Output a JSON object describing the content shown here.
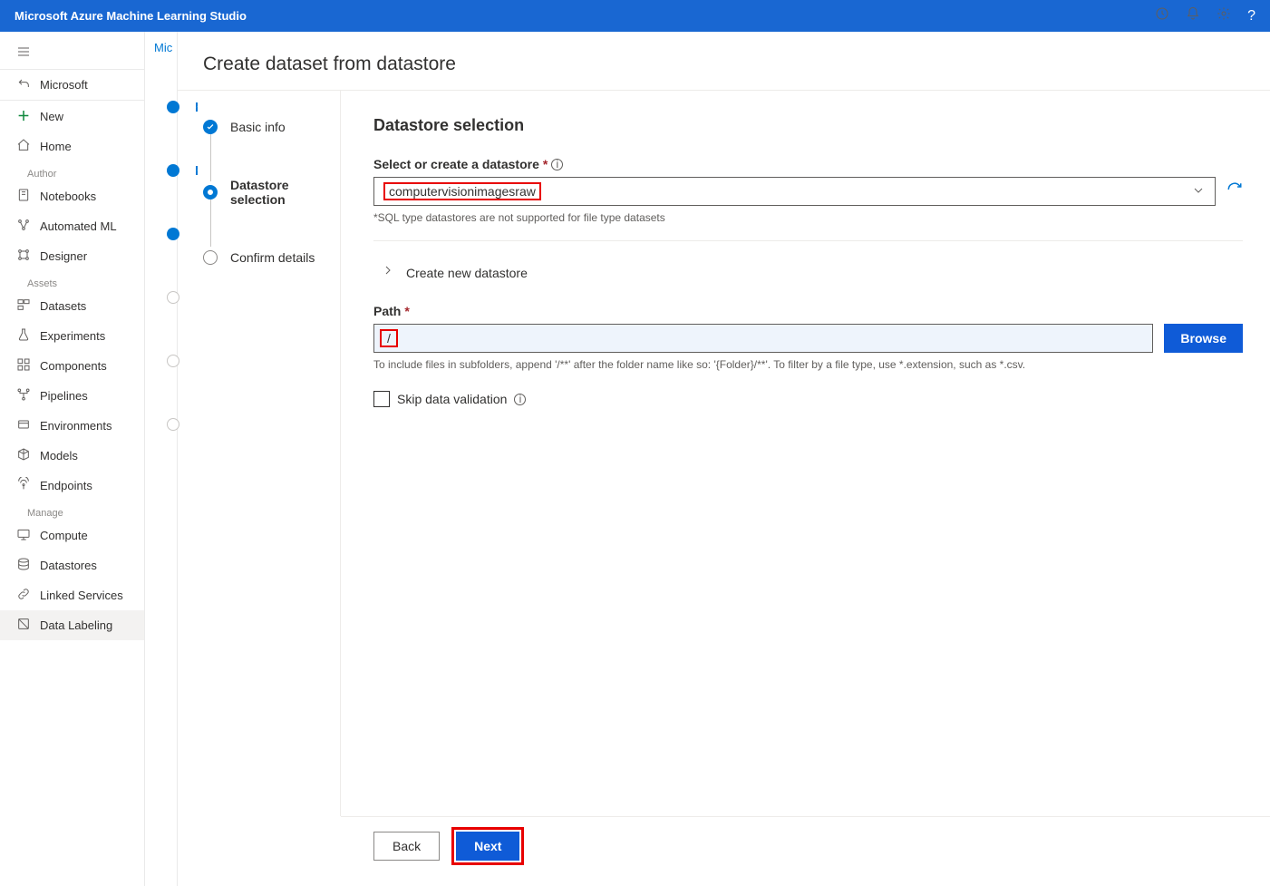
{
  "topbar": {
    "title": "Microsoft Azure Machine Learning Studio"
  },
  "breadcrumb": {
    "back_label": "Microsoft"
  },
  "sidebar": {
    "new_label": "New",
    "home_label": "Home",
    "sections": {
      "author": "Author",
      "assets": "Assets",
      "manage": "Manage"
    },
    "author_items": [
      {
        "label": "Notebooks"
      },
      {
        "label": "Automated ML"
      },
      {
        "label": "Designer"
      }
    ],
    "assets_items": [
      {
        "label": "Datasets"
      },
      {
        "label": "Experiments"
      },
      {
        "label": "Components"
      },
      {
        "label": "Pipelines"
      },
      {
        "label": "Environments"
      },
      {
        "label": "Models"
      },
      {
        "label": "Endpoints"
      }
    ],
    "manage_items": [
      {
        "label": "Compute"
      },
      {
        "label": "Datastores"
      },
      {
        "label": "Linked Services"
      },
      {
        "label": "Data Labeling"
      }
    ]
  },
  "peek_tab": "Mic",
  "wizard": {
    "title": "Create dataset from datastore",
    "steps": [
      {
        "label": "Basic info",
        "state": "done"
      },
      {
        "label": "Datastore selection",
        "state": "current"
      },
      {
        "label": "Confirm details",
        "state": "pending"
      }
    ],
    "form": {
      "heading": "Datastore selection",
      "datastore_label": "Select or create a datastore",
      "datastore_value": "computervisionimagesraw",
      "datastore_hint": "*SQL type datastores are not supported for file type datasets",
      "create_label": "Create new datastore",
      "path_label": "Path",
      "path_value": "/",
      "path_hint": "To include files in subfolders, append '/**' after the folder name like so: '{Folder}/**'. To filter by a file type, use *.extension, such as *.csv.",
      "browse_label": "Browse",
      "skip_label": "Skip data validation"
    },
    "footer": {
      "back_label": "Back",
      "next_label": "Next"
    }
  }
}
